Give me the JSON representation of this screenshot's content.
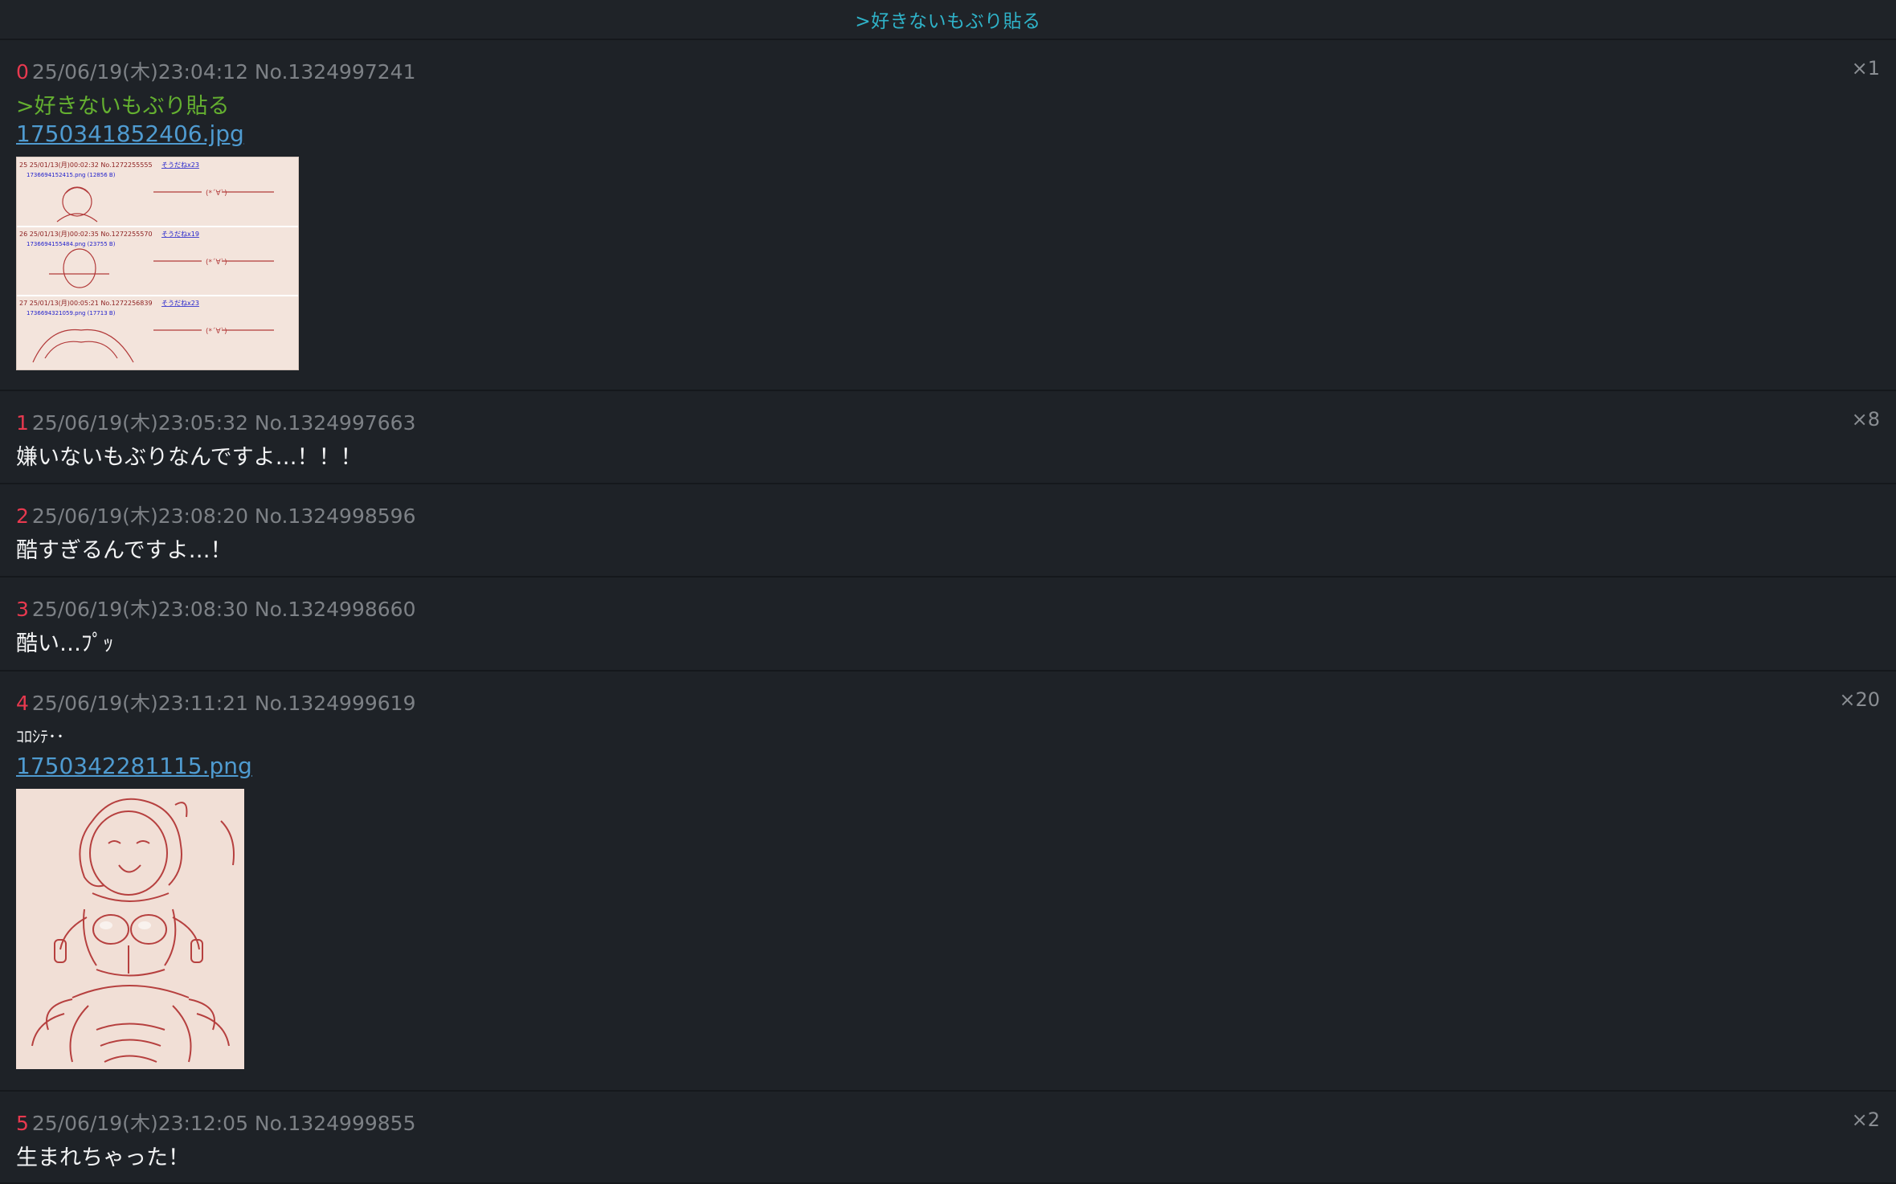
{
  "header": {
    "title": ">好きないもぶり貼る"
  },
  "posts": [
    {
      "num": "0",
      "meta": "25/06/19(木)23:04:12 No.1324997241",
      "count": "×1",
      "text": ">好きないもぶり貼る",
      "file": "1750341852406.jpg",
      "thumb_rows": [
        {
          "meta": "25 25/01/13(月)00:02:32  No.1272255555",
          "link": "そうだねx23",
          "file": "1736694152415.png (12856 B)"
        },
        {
          "meta": "26 25/01/13(月)00:02:35  No.1272255570",
          "link": "そうだねx19",
          "file": "1736694155484.png (23755 B)"
        },
        {
          "meta": "27 25/01/13(月)00:05:21  No.1272256839",
          "link": "そうだねx23",
          "file": "1736694321059.png (17713 B)"
        }
      ]
    },
    {
      "num": "1",
      "meta": "25/06/19(木)23:05:32 No.1324997663",
      "count": "×8",
      "text": "嫌いないもぶりなんですよ…！！！"
    },
    {
      "num": "2",
      "meta": "25/06/19(木)23:08:20 No.1324998596",
      "count": "",
      "text": "酷すぎるんですよ…！"
    },
    {
      "num": "3",
      "meta": "25/06/19(木)23:08:30 No.1324998660",
      "count": "",
      "text": "酷い…ﾌﾟｯ"
    },
    {
      "num": "4",
      "meta": "25/06/19(木)23:11:21 No.1324999619",
      "count": "×20",
      "text": "ｺﾛｼﾃ･･",
      "file": "1750342281115.png"
    },
    {
      "num": "5",
      "meta": "25/06/19(木)23:12:05 No.1324999855",
      "count": "×2",
      "text": "生まれちゃった！"
    }
  ]
}
